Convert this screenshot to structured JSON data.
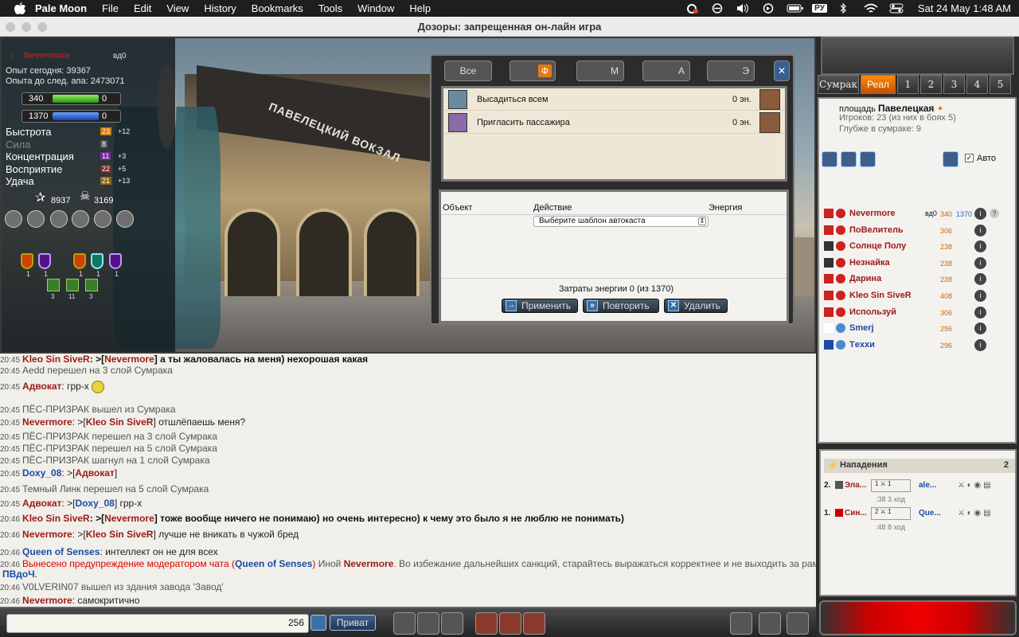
{
  "menubar": {
    "app": "Pale Moon",
    "items": [
      "File",
      "Edit",
      "View",
      "History",
      "Bookmarks",
      "Tools",
      "Window",
      "Help"
    ],
    "input_lang": "РУ",
    "datetime": "Sat 24 May  1:48 AM"
  },
  "window": {
    "title": "Дозоры: запрещенная он-лайн игра"
  },
  "player": {
    "name": "Nevermore",
    "level": "вд0",
    "exp_today": "Опыт сегодня: 39367",
    "exp_next": "Опыта до след. апа: 2473071",
    "hp": "340",
    "hp_extra": "0",
    "hp_fill": 1.0,
    "mp": "1370",
    "mp_extra": "0",
    "mp_fill": 1.0,
    "stats": [
      {
        "name": "Быстрота",
        "value": "23",
        "bonus": "+12",
        "dim": false,
        "color": "#d07a12"
      },
      {
        "name": "Сила",
        "value": "8",
        "bonus": "",
        "dim": true,
        "color": "#555"
      },
      {
        "name": "Концентрация",
        "value": "11",
        "bonus": "+3",
        "dim": false,
        "color": "#7a2a9a"
      },
      {
        "name": "Восприятие",
        "value": "22",
        "bonus": "+5",
        "dim": false,
        "color": "#7a2a2a"
      },
      {
        "name": "Удача",
        "value": "21",
        "bonus": "+13",
        "dim": false,
        "color": "#8a6a10"
      }
    ],
    "stars": "8937",
    "skulls": "3169",
    "shield_counts": [
      "1",
      "1",
      "1",
      "1",
      "1"
    ],
    "green_counts": [
      "3",
      "11",
      "3"
    ]
  },
  "dialog": {
    "tabs": [
      "Все",
      "Ф",
      "М",
      "А",
      "Э"
    ],
    "close": "✕",
    "passenger_rows": [
      {
        "label": "Высадиться всем",
        "energy": "0 эн."
      },
      {
        "label": "Пригласить пассажира",
        "energy": "0 эн."
      }
    ],
    "headers": {
      "object": "Объект",
      "action": "Действие",
      "energy": "Энергия"
    },
    "select_value": "Выберите шаблон автокаста",
    "select_arrow": "⇕",
    "energy_cost": "Затраты энергии 0 (из 1370)",
    "buttons": {
      "apply": "Применить",
      "repeat": "Повторить",
      "delete": "Удалить"
    }
  },
  "chat": [
    {
      "time": "20:45",
      "parts": [
        {
          "c": "n1",
          "t": "Kleo Sin SiveR"
        },
        {
          "c": "bold",
          "t": ": >["
        },
        {
          "c": "n1",
          "t": "Nevermore"
        },
        {
          "c": "bold",
          "t": "] а ты жаловалась на меня) нехорошая какая"
        }
      ]
    },
    {
      "time": "20:45",
      "parts": [
        {
          "c": "sys",
          "t": "Aedd перешел на 3 слой Сумрака"
        }
      ]
    },
    {
      "time": "20:45",
      "smile": true,
      "parts": [
        {
          "c": "n1",
          "t": "Адвокат"
        },
        {
          "c": "",
          "t": ":   грр-х"
        }
      ]
    },
    {
      "time": "20:45",
      "parts": [
        {
          "c": "sys",
          "t": "ПЁС-ПРИЗРАК вышел из Сумрака"
        }
      ]
    },
    {
      "time": "20:45",
      "parts": [
        {
          "c": "n1",
          "t": "Nevermore"
        },
        {
          "c": "",
          "t": ": >["
        },
        {
          "c": "n1",
          "t": "Kleo Sin SiveR"
        },
        {
          "c": "",
          "t": "]  отшлёпаешь меня?"
        }
      ]
    },
    {
      "time": "20:45",
      "parts": [
        {
          "c": "sys",
          "t": "ПЁС-ПРИЗРАК перешел на 3 слой Сумрака"
        }
      ]
    },
    {
      "time": "20:45",
      "parts": [
        {
          "c": "sys",
          "t": "ПЁС-ПРИЗРАК перешел на 5 слой Сумрака"
        }
      ]
    },
    {
      "time": "20:45",
      "parts": [
        {
          "c": "sys",
          "t": "ПЁС-ПРИЗРАК шагнул на 1 слой Сумрака"
        }
      ]
    },
    {
      "time": "20:45",
      "parts": [
        {
          "c": "n2",
          "t": "Doxy_08"
        },
        {
          "c": "",
          "t": ": >["
        },
        {
          "c": "n1",
          "t": "Адвокат"
        },
        {
          "c": "",
          "t": "]"
        }
      ]
    },
    {
      "time": "20:45",
      "parts": [
        {
          "c": "sys",
          "t": "Темный Линк перешел на 5 слой Сумрака"
        }
      ]
    },
    {
      "time": "20:45",
      "parts": [
        {
          "c": "n1",
          "t": "Адвокат"
        },
        {
          "c": "",
          "t": ": >["
        },
        {
          "c": "n2",
          "t": "Doxy_08"
        },
        {
          "c": "",
          "t": "]  грр-х"
        }
      ]
    },
    {
      "time": "20:46",
      "parts": [
        {
          "c": "n1",
          "t": "Kleo Sin SiveR"
        },
        {
          "c": "bold",
          "t": ": >["
        },
        {
          "c": "n1",
          "t": "Nevermore"
        },
        {
          "c": "bold",
          "t": "]  тоже вообще ничего не понимаю) но очень интересно) к чему это было  я не люблю не понимать)"
        }
      ]
    },
    {
      "time": "20:46",
      "parts": [
        {
          "c": "n1",
          "t": "Nevermore"
        },
        {
          "c": "",
          "t": ": >["
        },
        {
          "c": "n1",
          "t": "Kleo Sin SiveR"
        },
        {
          "c": "",
          "t": "]  лучше не вникать в чужой бред"
        }
      ]
    },
    {
      "time": "20:46",
      "parts": [
        {
          "c": "n2",
          "t": "Queen of Senses"
        },
        {
          "c": "",
          "t": ":   интеллект он не для всех"
        }
      ]
    },
    {
      "time": "20:46",
      "parts": [
        {
          "c": "warn",
          "t": "Вынесено предупреждение модератором чата ("
        },
        {
          "c": "n2",
          "t": "Queen of Senses"
        },
        {
          "c": "warn",
          "t": ")"
        },
        {
          "c": "sys",
          "t": " Иной "
        },
        {
          "c": "n1",
          "t": "Nevermore"
        },
        {
          "c": "sys",
          "t": ". Во избежание дальнейших санкций, старайтесь выражаться корректнее и не выходить за рамки"
        }
      ]
    },
    {
      "time": "",
      "parts": [
        {
          "c": "n2",
          "t": "ПВдоЧ"
        },
        {
          "c": "",
          "t": "."
        }
      ]
    },
    {
      "time": "20:46",
      "parts": [
        {
          "c": "sys",
          "t": "V0LVERIN07 вышел из здания завода 'Завод'"
        }
      ]
    },
    {
      "time": "20:46",
      "parts": [
        {
          "c": "n1",
          "t": "Nevermore"
        },
        {
          "c": "",
          "t": ":   самокритично"
        }
      ]
    }
  ],
  "input_bar": {
    "char_count": "256",
    "private_label": "Приват"
  },
  "right": {
    "tabs": [
      "Сумрак",
      "Реал",
      "1",
      "2",
      "3",
      "4",
      "5"
    ],
    "place_label": "площадь",
    "place_name": "Павелецкая",
    "players_info": "Игроков: 23 (из них в боях 5)",
    "depth_info": "Глубже в сумраке: 9",
    "auto_label": "Авто",
    "users": [
      {
        "name": "Nevermore",
        "level": "вд0",
        "hp": "340",
        "mp": "1370",
        "blue": false
      },
      {
        "name": "ПоВелитель",
        "level": "",
        "hp": "306",
        "mp": "",
        "blue": false
      },
      {
        "name": "Солнце Полу",
        "level": "",
        "hp": "238",
        "mp": "",
        "blue": false
      },
      {
        "name": "Незнайка",
        "level": "",
        "hp": "238",
        "mp": "",
        "blue": false
      },
      {
        "name": "Дарина",
        "level": "",
        "hp": "238",
        "mp": "",
        "blue": false
      },
      {
        "name": "Kleo Sin SiveR",
        "level": "",
        "hp": "408",
        "mp": "",
        "blue": false
      },
      {
        "name": "Используй",
        "level": "",
        "hp": "306",
        "mp": "",
        "blue": false
      },
      {
        "name": "Smerj",
        "level": "",
        "hp": "296",
        "mp": "",
        "blue": true
      },
      {
        "name": "Тexxи",
        "level": "",
        "hp": "296",
        "mp": "",
        "blue": true
      }
    ],
    "attacks_title": "Нападения",
    "attacks_count": "2",
    "attacks": [
      {
        "num": "2.",
        "name": "Эла...",
        "w1": "1",
        "w2": "1",
        "b": "ale...",
        "t": ":38",
        "moves": "3 ход"
      },
      {
        "num": "1.",
        "name": "Син...",
        "w1": "2",
        "w2": "1",
        "b": "Que...",
        "t": ":48",
        "moves": "8 ход"
      }
    ]
  }
}
